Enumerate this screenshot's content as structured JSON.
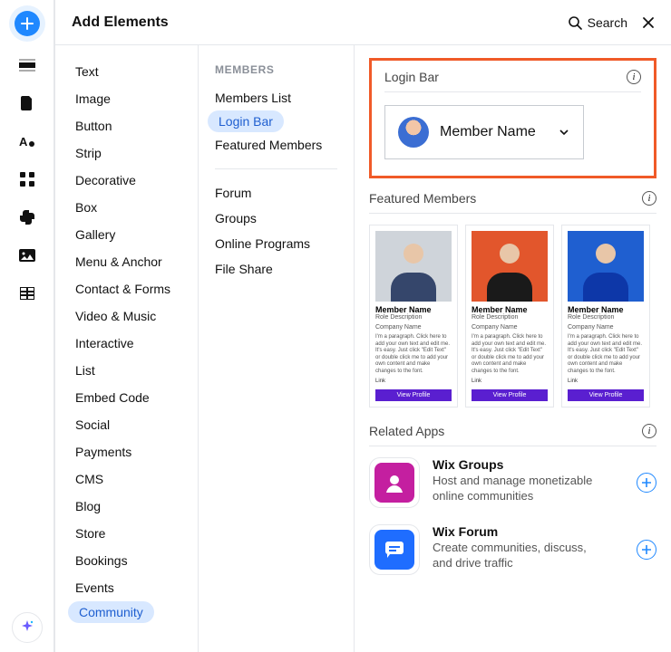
{
  "header": {
    "title": "Add Elements",
    "search_label": "Search"
  },
  "rail": {
    "icons": [
      "add",
      "section",
      "page",
      "text-style",
      "apps",
      "plugins",
      "media",
      "table",
      "sparkle"
    ]
  },
  "categories": [
    "Text",
    "Image",
    "Button",
    "Strip",
    "Decorative",
    "Box",
    "Gallery",
    "Menu & Anchor",
    "Contact & Forms",
    "Video & Music",
    "Interactive",
    "List",
    "Embed Code",
    "Social",
    "Payments",
    "CMS",
    "Blog",
    "Store",
    "Bookings",
    "Events",
    "Community"
  ],
  "selected_category": "Community",
  "subnav": {
    "heading": "MEMBERS",
    "group1": [
      "Members List",
      "Login Bar",
      "Featured Members"
    ],
    "group2": [
      "Forum",
      "Groups",
      "Online Programs",
      "File Share"
    ],
    "selected": "Login Bar"
  },
  "sections": {
    "login_bar": {
      "title": "Login Bar",
      "member_label": "Member Name"
    },
    "featured": {
      "title": "Featured Members",
      "cards": [
        {
          "name": "Member Name",
          "role": "Role Description",
          "company": "Company Name",
          "para": "I'm a paragraph. Click here to add your own text and edit me. It's easy. Just click \"Edit Text\" or double click me to add your own content and make changes to the font.",
          "link": "Link",
          "btn": "View Profile"
        },
        {
          "name": "Member Name",
          "role": "Role Description",
          "company": "Company Name",
          "para": "I'm a paragraph. Click here to add your own text and edit me. It's easy. Just click \"Edit Text\" or double click me to add your own content and make changes to the font.",
          "link": "Link",
          "btn": "View Profile"
        },
        {
          "name": "Member Name",
          "role": "Role Description",
          "company": "Company Name",
          "para": "I'm a paragraph. Click here to add your own text and edit me. It's easy. Just click \"Edit Text\" or double click me to add your own content and make changes to the font.",
          "link": "Link",
          "btn": "View Profile"
        }
      ]
    },
    "related": {
      "title": "Related Apps",
      "apps": [
        {
          "title": "Wix Groups",
          "desc": "Host and manage monetizable online communities",
          "icon_bg": "#c41fa0"
        },
        {
          "title": "Wix Forum",
          "desc": "Create communities, discuss, and drive traffic",
          "icon_bg": "#1f6dff"
        }
      ]
    }
  }
}
